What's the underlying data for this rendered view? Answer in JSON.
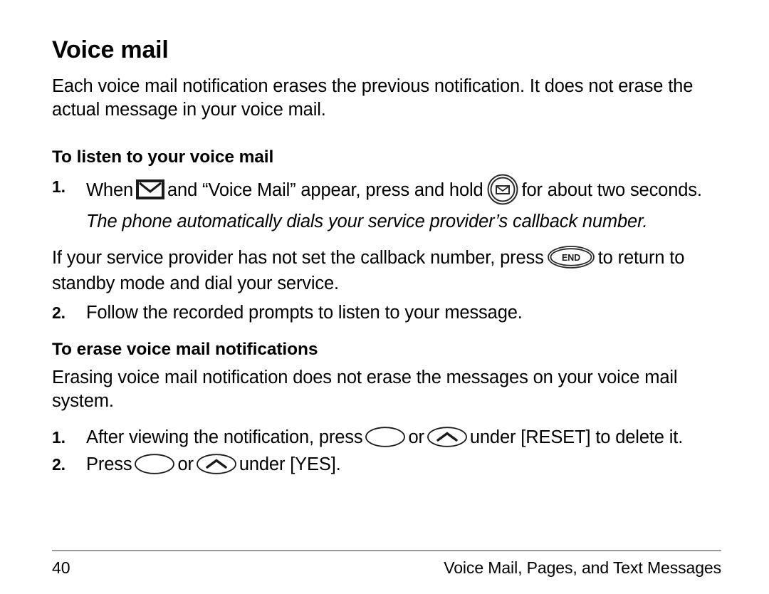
{
  "document": {
    "title": "Voice mail",
    "intro": "Each voice mail notification erases the previous notification. It does not erase the actual message in your voice mail.",
    "sections": [
      {
        "heading": "To listen to your voice mail",
        "steps": [
          {
            "number": "1.",
            "text_before_envelope": "When",
            "text_after_envelope": "and “Voice Mail” appear, press and hold",
            "text_after_key": "for about two seconds.",
            "italic_note": "The phone automatically dials your service provider’s callback number."
          },
          {
            "number": "2.",
            "text": "Follow the recorded prompts to listen to your message."
          }
        ],
        "note_paragraph": {
          "before_key": "If your service provider has not set the callback number, press",
          "after_key": "to return to standby mode and dial your service."
        }
      },
      {
        "heading": "To erase voice mail notifications",
        "intro": "Erasing voice mail notification does not erase the messages on your voice mail system.",
        "steps": [
          {
            "number": "1.",
            "before_softkey": "After viewing the notification, press",
            "between_softkeys": "or",
            "after_softkeys": "under [RESET] to delete it."
          },
          {
            "number": "2.",
            "before_softkey": "Press",
            "between_softkeys": "or",
            "after_softkeys": "under [YES]."
          }
        ]
      }
    ],
    "icons": {
      "envelope_indicator": "envelope-icon",
      "message_key": "message-round-key-icon",
      "end_key_label": "END",
      "end_key": "end-key-icon",
      "softkey_left": "left-softkey-oval-icon",
      "softkey_right": "right-softkey-chevron-icon"
    },
    "footer": {
      "page_number": "40",
      "section_title": "Voice Mail, Pages, and Text Messages",
      "rule_color": "#9a9a9a"
    }
  }
}
